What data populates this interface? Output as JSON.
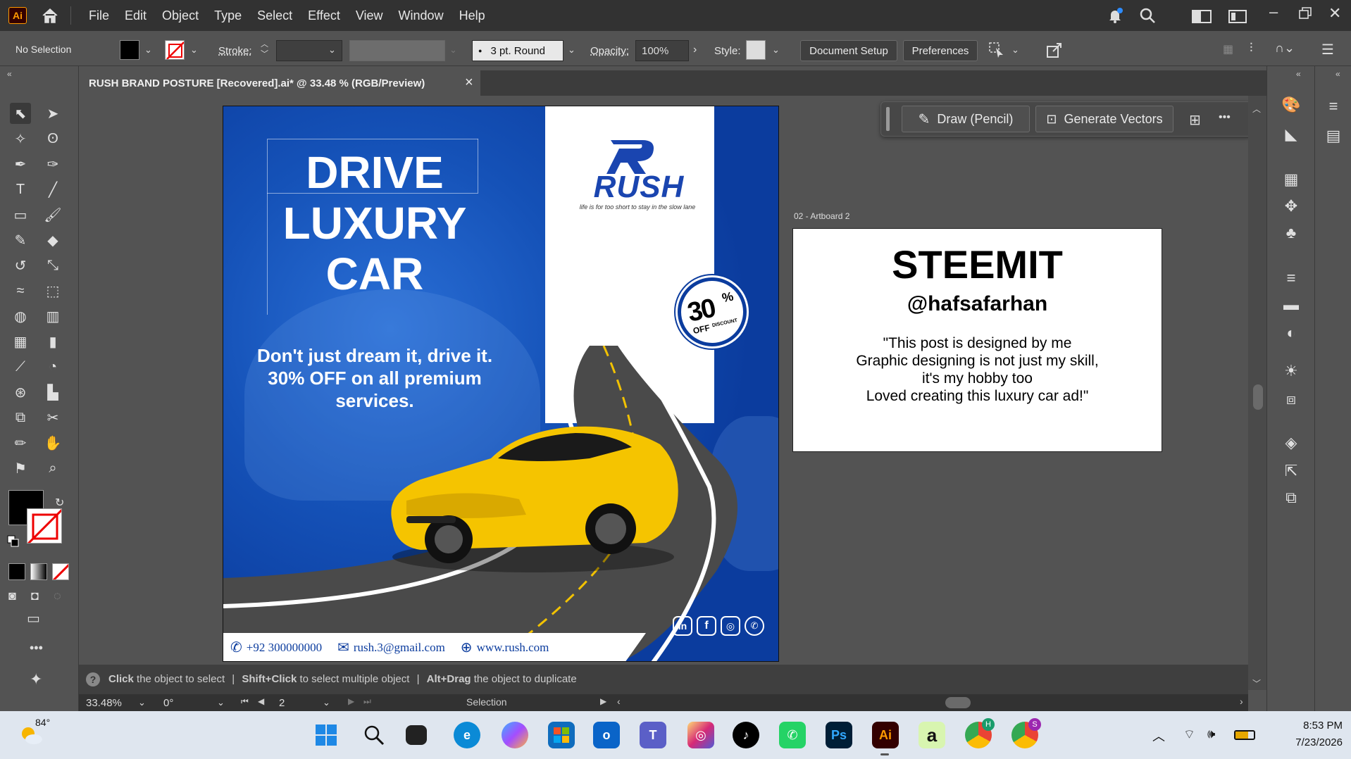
{
  "menubar": {
    "app_logo": "Ai",
    "items": [
      "File",
      "Edit",
      "Object",
      "Type",
      "Select",
      "Effect",
      "View",
      "Window",
      "Help"
    ]
  },
  "controlbar": {
    "selection_label": "No Selection",
    "stroke_label": "Stroke:",
    "brush_value": "3 pt. Round",
    "opacity_label": "Opacity:",
    "opacity_value": "100%",
    "style_label": "Style:",
    "document_setup": "Document Setup",
    "preferences": "Preferences"
  },
  "document_tab": {
    "title": "RUSH BRAND POSTURE [Recovered].ai* @ 33.48 % (RGB/Preview)",
    "close": "×"
  },
  "context_bar": {
    "draw_pencil": "Draw (Pencil)",
    "generate_vectors": "Generate Vectors",
    "more": "•••"
  },
  "artboard1": {
    "headline": [
      "DRIVE",
      "LUXURY",
      "CAR"
    ],
    "tagline": [
      "Don't just dream it, drive it.",
      "30% OFF on all premium",
      "services."
    ],
    "brand": "RUSH",
    "brand_tagline": "life is for too short to stay in the slow lane",
    "discount_value": "30",
    "discount_pct": "%",
    "discount_off": "OFF",
    "discount_word": "DISCOUNT",
    "phone": "+92 300000000",
    "email": "rush.3@gmail.com",
    "website": "www.rush.com"
  },
  "artboard2": {
    "label": "02 - Artboard 2",
    "title": "STEEMIT",
    "handle": "@hafsafarhan",
    "quote": [
      "\"This post is designed by me",
      "Graphic designing is not just my skill,",
      "it's my hobby too",
      "Loved creating this luxury car ad!\""
    ]
  },
  "status": {
    "hint_1_bold": "Click",
    "hint_1": "the object to select",
    "hint_2_bold": "Shift+Click",
    "hint_2": "to select multiple object",
    "hint_3_bold": "Alt+Drag",
    "hint_3": "the object to duplicate",
    "sep": "|"
  },
  "bottombar": {
    "zoom": "33.48%",
    "rotation": "0°",
    "artboard_num": "2",
    "tool": "Selection"
  },
  "taskbar": {
    "weather_temp": "84°",
    "time": "8:53 PM",
    "date": "7/23/2026"
  },
  "colors": {
    "artboard_blue": "#0b3c9e",
    "accent_orange": "#ff9a00",
    "car_yellow": "#f5c400"
  }
}
